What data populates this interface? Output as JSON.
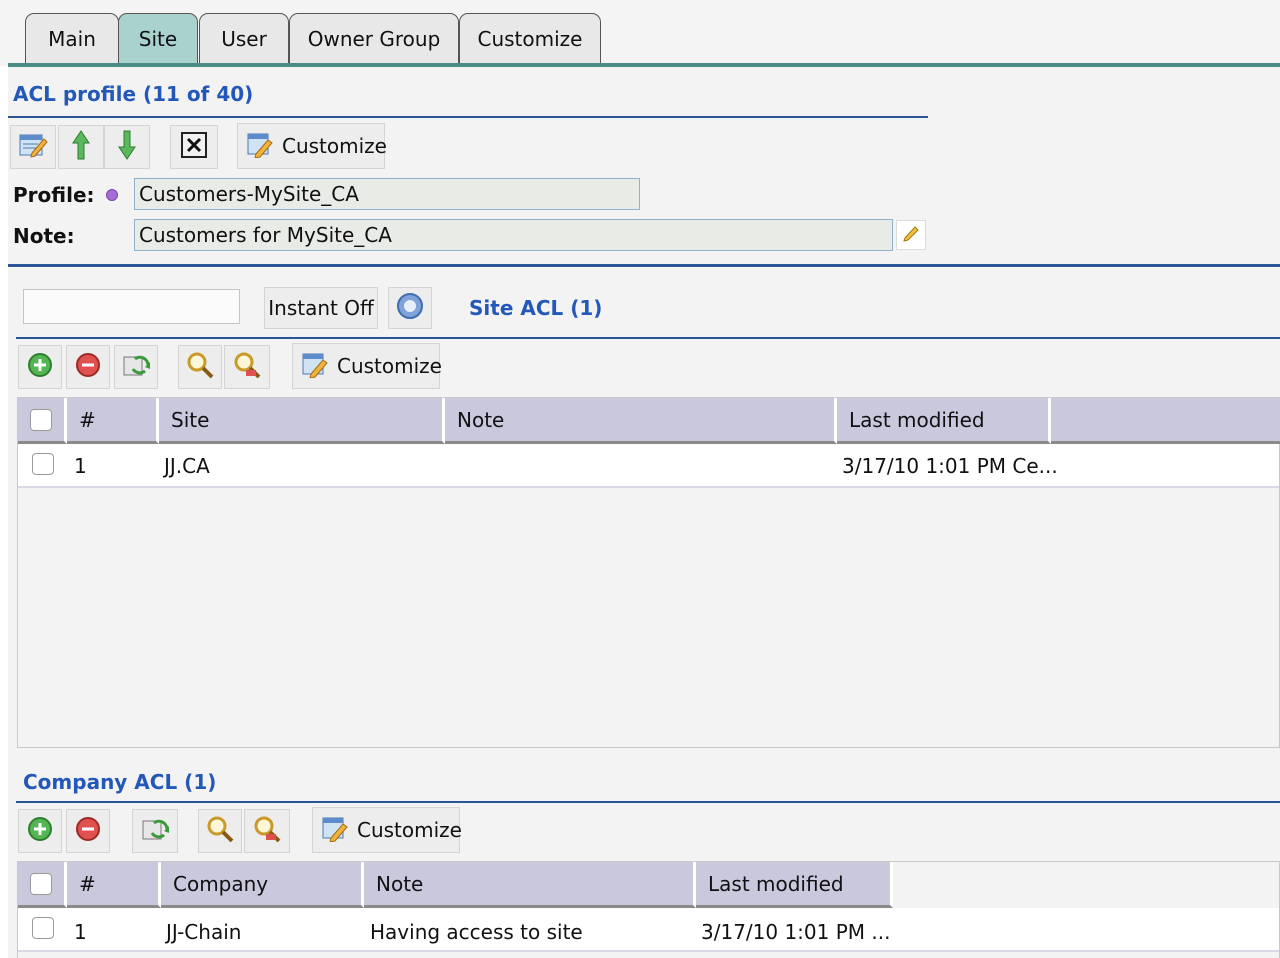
{
  "tabs": [
    {
      "label": "Main",
      "active": false
    },
    {
      "label": "Site",
      "active": true
    },
    {
      "label": "User",
      "active": false
    },
    {
      "label": "Owner Group",
      "active": false
    },
    {
      "label": "Customize",
      "active": false
    }
  ],
  "profile_section": {
    "title": "ACL profile (11 of 40)",
    "customize_label": "Customize",
    "profile_label": "Profile:",
    "profile_value": "Customers-MySite_CA",
    "note_label": "Note:",
    "note_value": "Customers for MySite_CA"
  },
  "search": {
    "value": "",
    "instant_label": "Instant Off"
  },
  "site_acl": {
    "title": "Site ACL (1)",
    "customize_label": "Customize",
    "columns": [
      "#",
      "Site",
      "Note",
      "Last modified"
    ],
    "rows": [
      {
        "num": "1",
        "site": "JJ.CA",
        "note": "",
        "modified": "3/17/10 1:01 PM Ce..."
      }
    ]
  },
  "company_acl": {
    "title": "Company ACL (1)",
    "customize_label": "Customize",
    "columns": [
      "#",
      "Company",
      "Note",
      "Last modified"
    ],
    "rows": [
      {
        "num": "1",
        "company": "JJ-Chain",
        "note": "Having access to site",
        "modified": "3/17/10 1:01 PM ..."
      }
    ]
  },
  "colors": {
    "accent_title": "#2458b8",
    "active_tab": "#a9d2cf",
    "tab_line": "#4b8c86",
    "grid_header": "#c9c8dc"
  }
}
